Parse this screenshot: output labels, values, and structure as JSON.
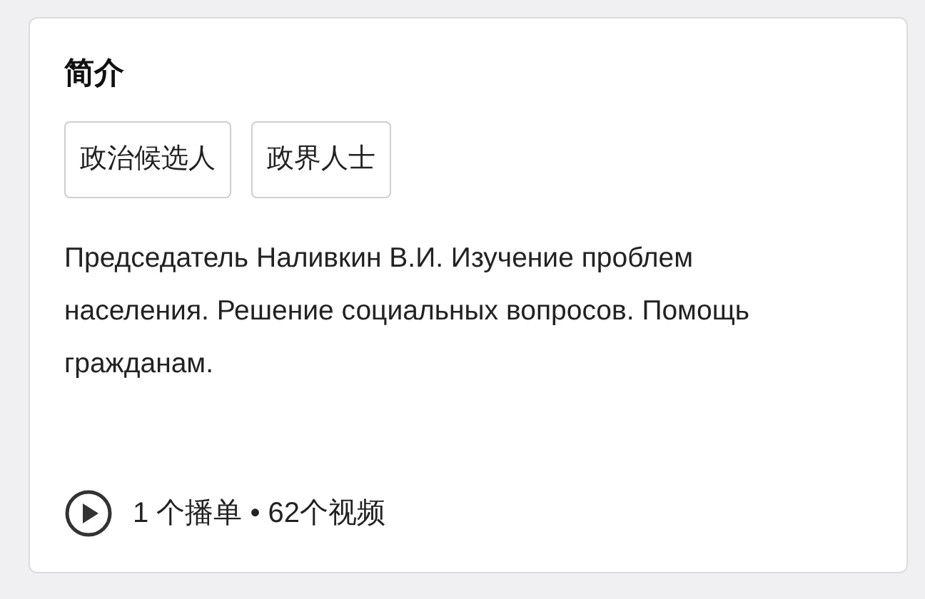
{
  "section": {
    "title": "简介"
  },
  "tags": [
    {
      "label": "政治候选人"
    },
    {
      "label": "政界人士"
    }
  ],
  "description": "Председатель Наливкин В.И. Изучение проблем населения. Решение социальных вопросов. Помощь гражданам.",
  "footer": {
    "text": "1 个播单 • 62个视频"
  }
}
